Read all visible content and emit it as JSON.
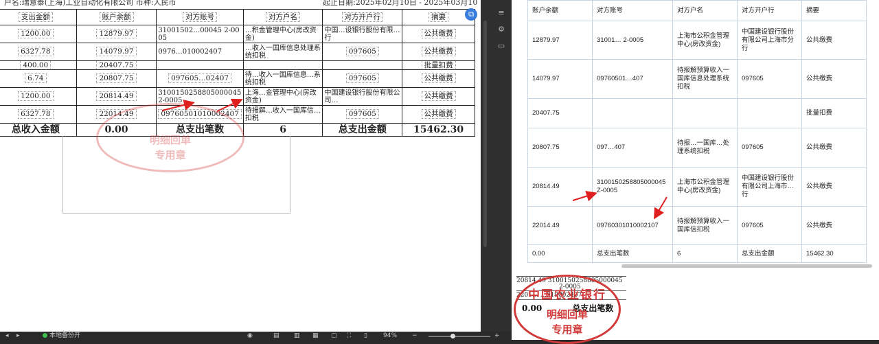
{
  "doc": {
    "header_left": "户名:瑞意泰(上海)工业自动化有限公司   币种:人民币",
    "header_right": "起止日期:2025年02月10日 - 2025年03月10",
    "columns": [
      "支出金额",
      "账户余额",
      "对方账号",
      "对方户名",
      "对方开户行",
      "摘要"
    ],
    "rows": [
      {
        "out": "1200.00",
        "bal": "12879.97",
        "acct": "31001502…00045 2-0005",
        "name": "…积金管理中心(房改资金)",
        "bank": "中国…设银行股份有限…行",
        "memo": "公共缴费"
      },
      {
        "out": "6327.78",
        "bal": "14079.97",
        "acct": "0976…010002407",
        "name": "…收入一国库信息处理系统扣税",
        "bank": "097605",
        "memo": "公共缴费"
      },
      {
        "out": "400.00",
        "bal": "20407.75",
        "acct": "",
        "name": "",
        "bank": "",
        "memo": "批量扣费"
      },
      {
        "out": "6.74",
        "bal": "20807.75",
        "acct": "097605…02407",
        "name": "待…收入一国库信息…系统扣税",
        "bank": "097605",
        "memo": "公共缴费"
      },
      {
        "out": "1200.00",
        "bal": "20814.49",
        "acct": "3100150258805000045 2-0005",
        "name": "上海…金管理中心(房改资金)",
        "bank": "中国建设银行股份有限公司…",
        "memo": "公共缴费"
      },
      {
        "out": "6327.78",
        "bal": "22014.49",
        "acct": "09760501010002407",
        "name": "待报解…收入一国库信…扣税",
        "bank": "097605",
        "memo": "公共缴费"
      }
    ],
    "total": {
      "label_in": "总收入金额",
      "in": "0.00",
      "label_count": "总支出笔数",
      "count": "6",
      "label_out": "总支出金额",
      "out": "15462.30"
    },
    "stamp": {
      "line1": "明细回单",
      "line2": "专用章"
    }
  },
  "status_bar": {
    "backup": "本地备份开",
    "zoom": "94%"
  },
  "web": {
    "columns": [
      "账户余额",
      "对方账号",
      "对方户名",
      "对方开户行",
      "摘要"
    ],
    "rows": [
      {
        "bal": "12879.97",
        "acct": "31001… 2-0005",
        "name": "上海市公积金管理中心(房改资金)",
        "bank": "中国建设银行股份有限公司上海市分行",
        "memo": "公共缴费"
      },
      {
        "bal": "14079.97",
        "acct": "09760501…407",
        "name": "待报解预算收入一国库信息处理系统扣税",
        "bank": "097605",
        "memo": "公共缴费"
      },
      {
        "bal": "20407.75",
        "acct": "",
        "name": "",
        "bank": "",
        "memo": "批量扣费"
      },
      {
        "bal": "20807.75",
        "acct": "097…407",
        "name": "待报…一国库…处理系统扣税",
        "bank": "097605",
        "memo": "公共缴费"
      },
      {
        "bal": "20814.49",
        "acct": "3100150258805000045Z-0005",
        "name": "上海市公积金管理中心(房改资金)",
        "bank": "中国建设银行股份有限公司上海市…行",
        "memo": "公共缴费"
      },
      {
        "bal": "22014.49",
        "acct": "09760301010002107",
        "name": "待报解预算收入一国库信扣税",
        "bank": "097605",
        "memo": "公共缴费"
      }
    ],
    "total": {
      "bal": "0.00",
      "acct": "总支出笔数",
      "name": "6",
      "bank": "总支出金额",
      "memo": "15462.30"
    },
    "mini": {
      "r1": "20814.49  3100150258805000045",
      "r2": "2-0005",
      "r3": "2201…  …010002407",
      "total_in": "0.00",
      "total_label": "总支出笔数",
      "stamp_top": "中国农业银行",
      "stamp_l1": "明细回单",
      "stamp_l2": "专用章"
    }
  }
}
